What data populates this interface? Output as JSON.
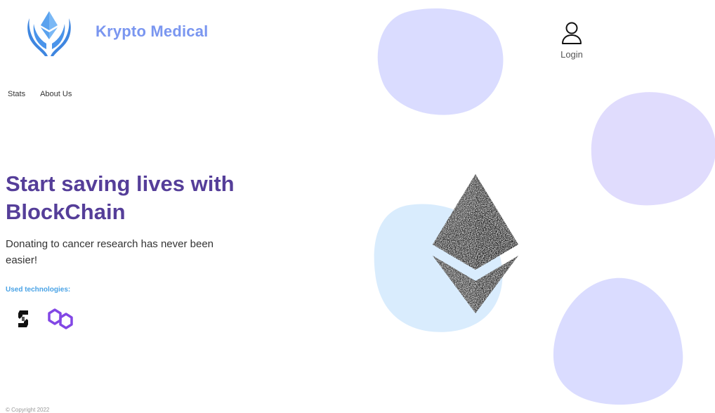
{
  "brand": {
    "name": "Krypto Medical"
  },
  "header": {
    "login_label": "Login"
  },
  "nav": {
    "items": [
      {
        "label": "Stats"
      },
      {
        "label": "About Us"
      }
    ]
  },
  "hero": {
    "title": "Start saving lives with BlockChain",
    "subtitle": "Donating to cancer research has never been easier!"
  },
  "technologies": {
    "label": "Used technologies:",
    "icons": [
      "solana-icon",
      "polygon-icon"
    ]
  },
  "footer": {
    "copyright": "© Copyright 2022"
  },
  "colors": {
    "brand": "#7a96f0",
    "hero_title": "#553e99",
    "tech_label": "#4aa3e6",
    "blob_lavender": "#dadcff",
    "blob_violet": "#e0dcfd",
    "blob_blue": "#d9ecfd",
    "polygon": "#8247e5"
  }
}
